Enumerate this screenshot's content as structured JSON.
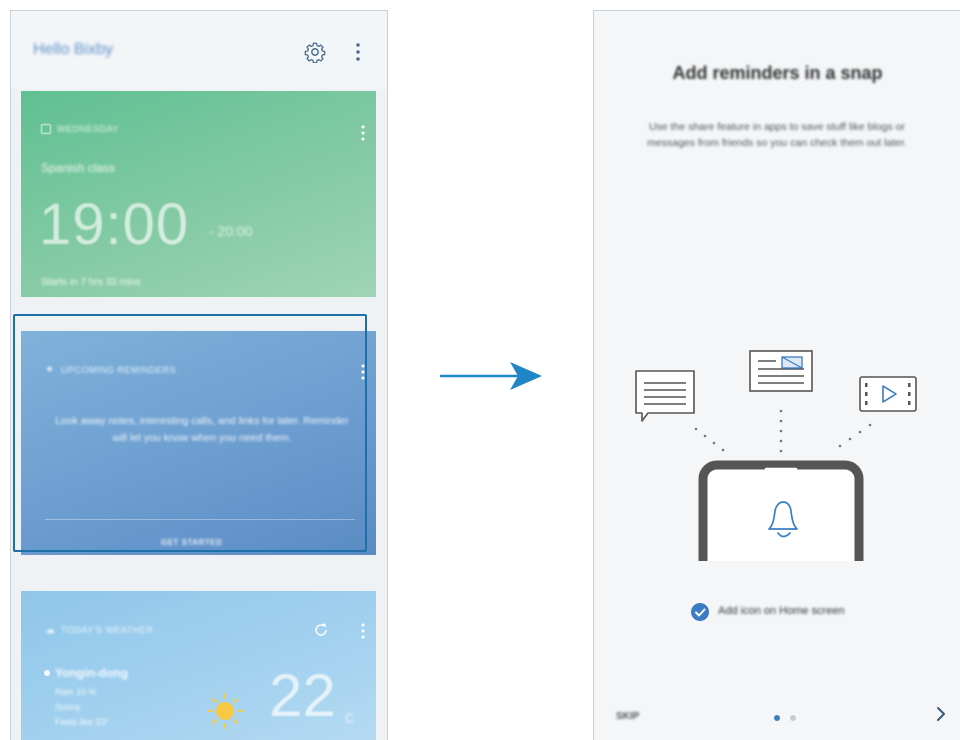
{
  "left_screen": {
    "header": {
      "greeting": "Hello Bixby",
      "settings_icon": "gear-icon",
      "more_icon": "more-vertical-icon"
    },
    "event_card": {
      "color": "#6cc49a",
      "date_label": "WEDNESDAY",
      "title": "Spanish class",
      "start_time": "19:00",
      "end_time": "- 20:00",
      "countdown": "Starts in 7 hrs 33 mins"
    },
    "reminder_card": {
      "color": "#6e9fd1",
      "category": "UPCOMING REMINDERS",
      "body": "Look away notes, interesting calls, and links for later. Reminder will let you know when you need them.",
      "action": "GET STARTED"
    },
    "weather_card": {
      "color": "#9ccbec",
      "category": "TODAY'S WEATHER",
      "location": "Yongin-dong",
      "detail_1": "Rain 10 %",
      "detail_2": "Sunny",
      "detail_3": "Feels like 23°",
      "temperature": "22",
      "unit": "c"
    },
    "selection_color": "#1f6fa8"
  },
  "arrow_color": "#1f86c8",
  "right_screen": {
    "title": "Add reminders in a snap",
    "description": "Use the share feature in apps to save stuff like blogs or messages from friends so you can check them out later.",
    "checkbox_label": "Add icon on Home screen",
    "checkbox_checked": true,
    "skip_label": "SKIP",
    "page_indicator": {
      "current": 1,
      "total": 2
    },
    "next_icon": "chevron-right-icon",
    "accent_color": "#3b7cc4"
  }
}
